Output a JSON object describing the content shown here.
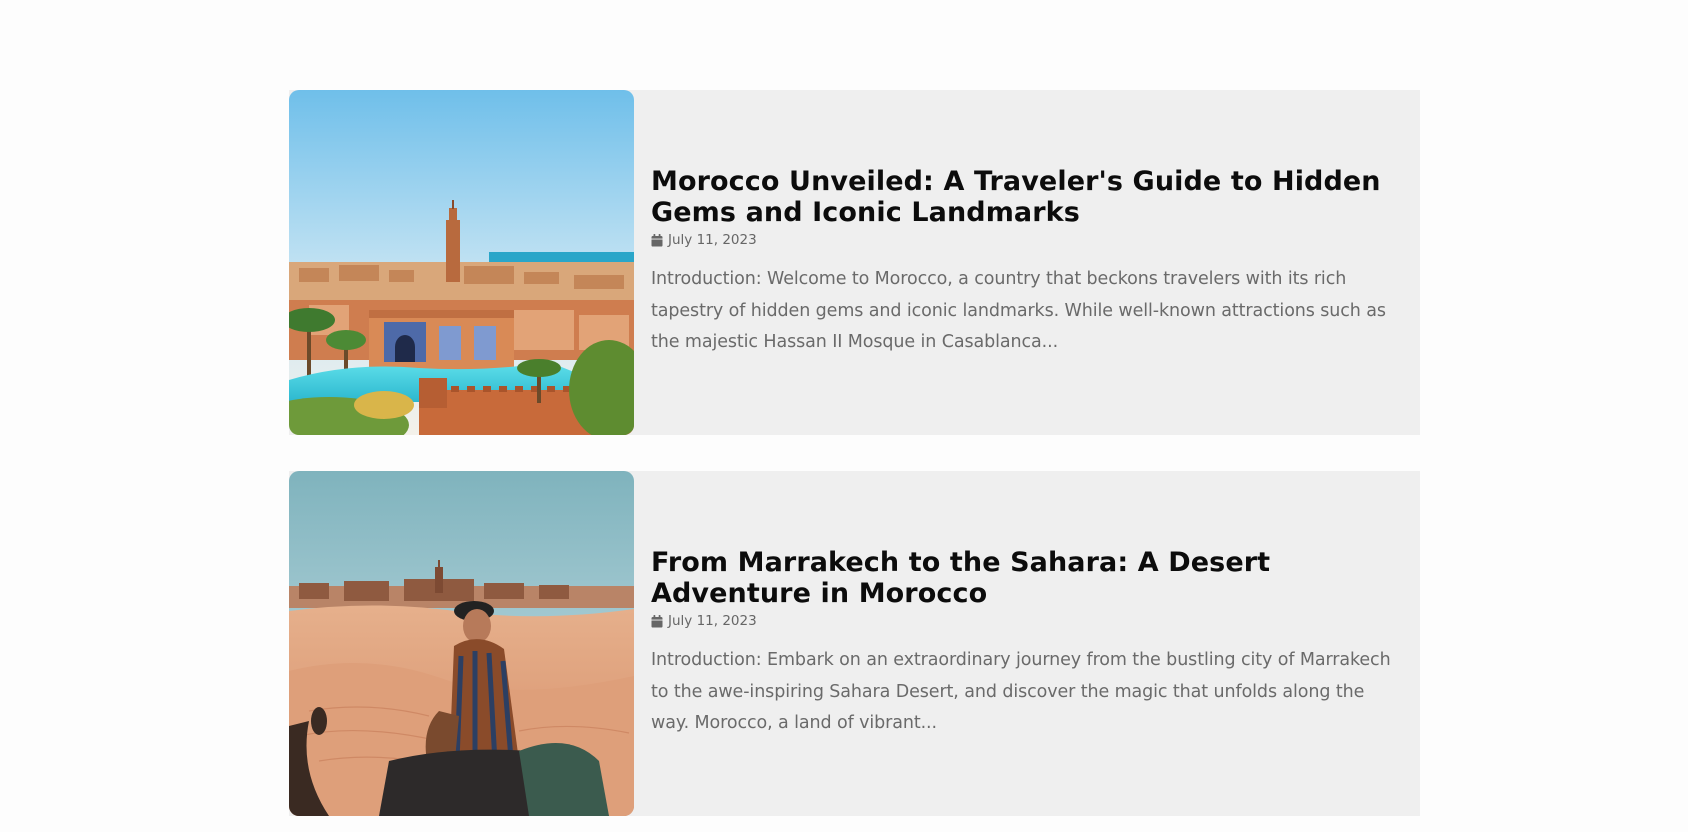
{
  "posts": [
    {
      "title": "Morocco Unveiled: A Traveler's Guide to Hidden Gems and Iconic Landmarks",
      "date": "July 11, 2023",
      "excerpt": "Introduction: Welcome to Morocco, a country that beckons travelers with its rich tapestry of hidden gems and iconic landmarks. While well-known attractions such as the majestic Hassan II Mosque in Casablanca...",
      "thumbnail": "marrakech-city-thumbnail",
      "date_icon": "calendar-icon"
    },
    {
      "title": "From Marrakech to the Sahara: A Desert Adventure in Morocco",
      "date": "July 11, 2023",
      "excerpt": "Introduction: Embark on an extraordinary journey from the bustling city of Marrakech to the awe-inspiring Sahara Desert, and discover the magic that unfolds along the way. Morocco, a land of vibrant...",
      "thumbnail": "sahara-desert-thumbnail",
      "date_icon": "calendar-icon"
    }
  ],
  "colors": {
    "card_background": "#efefef",
    "title": "#0c0c0c",
    "meta": "#666666",
    "excerpt": "#6a6a6a"
  }
}
